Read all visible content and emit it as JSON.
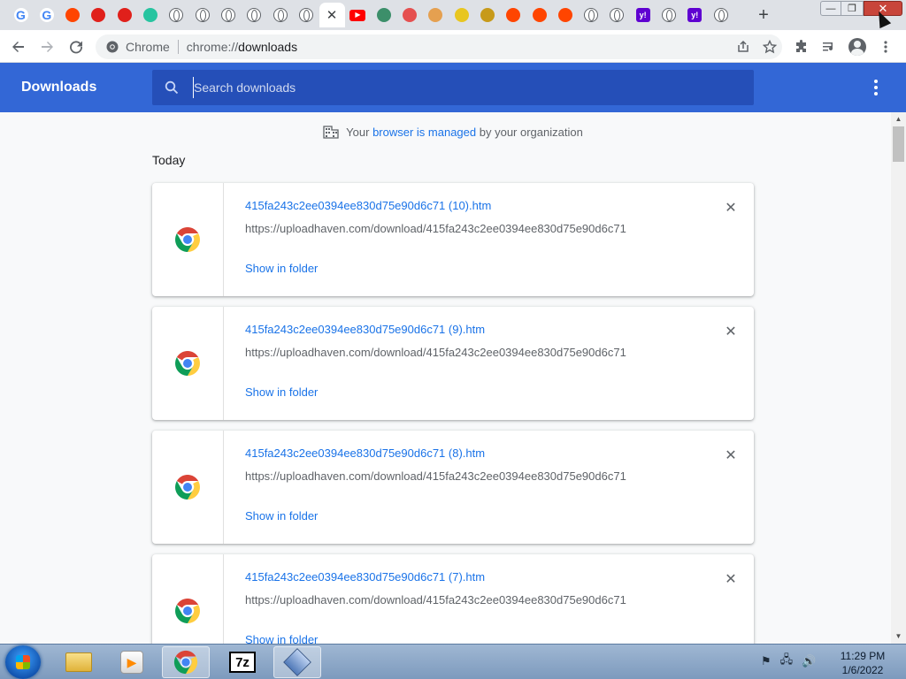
{
  "tabs": [
    {
      "icon": "google-icon",
      "label": "G",
      "color": "#4285f4"
    },
    {
      "icon": "google-icon",
      "label": "G",
      "color": "#4285f4"
    },
    {
      "icon": "reddit-icon",
      "label": "",
      "color": "#ff4500"
    },
    {
      "icon": "app-icon-red",
      "label": "",
      "color": "#e0201b"
    },
    {
      "icon": "app-icon-red",
      "label": "",
      "color": "#e0201b"
    },
    {
      "icon": "app-icon-teal",
      "label": "",
      "color": "#27c4a0"
    },
    {
      "icon": "globe-icon",
      "label": "",
      "color": "#5f6368"
    },
    {
      "icon": "globe-icon",
      "label": "",
      "color": "#5f6368"
    },
    {
      "icon": "globe-icon",
      "label": "",
      "color": "#5f6368"
    },
    {
      "icon": "globe-icon",
      "label": "",
      "color": "#5f6368"
    },
    {
      "icon": "globe-icon",
      "label": "",
      "color": "#5f6368"
    },
    {
      "icon": "globe-icon",
      "label": "",
      "color": "#5f6368"
    },
    {
      "icon": "close-icon",
      "label": "✕",
      "color": "#3c4043",
      "active": true
    },
    {
      "icon": "youtube-icon",
      "label": "▶",
      "color": "#ff0000"
    },
    {
      "icon": "cat-icon",
      "label": "",
      "color": "#3c8f6a"
    },
    {
      "icon": "app-icon-red",
      "label": "",
      "color": "#e55050"
    },
    {
      "icon": "app-icon-orange",
      "label": "",
      "color": "#e5a050"
    },
    {
      "icon": "app-icon-yellow",
      "label": "",
      "color": "#e8c620"
    },
    {
      "icon": "app-icon-badge",
      "label": "",
      "color": "#c79a1a"
    },
    {
      "icon": "reddit-icon",
      "label": "",
      "color": "#ff4500"
    },
    {
      "icon": "reddit-icon",
      "label": "",
      "color": "#ff4500"
    },
    {
      "icon": "reddit-icon",
      "label": "",
      "color": "#ff4500"
    },
    {
      "icon": "globe-icon",
      "label": "",
      "color": "#5f6368"
    },
    {
      "icon": "globe-icon",
      "label": "",
      "color": "#5f6368"
    },
    {
      "icon": "yahoo-icon",
      "label": "y!",
      "color": "#5f01d1"
    },
    {
      "icon": "globe-icon",
      "label": "",
      "color": "#5f6368"
    },
    {
      "icon": "yahoo-icon",
      "label": "y!",
      "color": "#5f01d1"
    },
    {
      "icon": "globe-icon",
      "label": "",
      "color": "#5f6368"
    }
  ],
  "window": {
    "minimize": "—",
    "maximize": "❐",
    "close": "✕"
  },
  "toolbar": {
    "chip_label": "Chrome",
    "url_scheme": "chrome://",
    "url_path": "downloads"
  },
  "downloads": {
    "title": "Downloads",
    "search_placeholder": "Search downloads",
    "managed_prefix": "Your",
    "managed_link": "browser is managed",
    "managed_suffix": "by your organization",
    "section_date": "Today",
    "show_in_folder": "Show in folder",
    "items": [
      {
        "filename": "415fa243c2ee0394ee830d75e90d6c71 (10).htm",
        "url": "https://uploadhaven.com/download/415fa243c2ee0394ee830d75e90d6c71"
      },
      {
        "filename": "415fa243c2ee0394ee830d75e90d6c71 (9).htm",
        "url": "https://uploadhaven.com/download/415fa243c2ee0394ee830d75e90d6c71"
      },
      {
        "filename": "415fa243c2ee0394ee830d75e90d6c71 (8).htm",
        "url": "https://uploadhaven.com/download/415fa243c2ee0394ee830d75e90d6c71"
      },
      {
        "filename": "415fa243c2ee0394ee830d75e90d6c71 (7).htm",
        "url": "https://uploadhaven.com/download/415fa243c2ee0394ee830d75e90d6c71"
      }
    ]
  },
  "taskbar": {
    "items": [
      "windows-explorer",
      "windows-media-player",
      "google-chrome",
      "7-zip",
      "virtualbox"
    ],
    "active": "google-chrome",
    "time": "11:29 PM",
    "date": "1/6/2022"
  },
  "colors": {
    "header_blue": "#3367d6",
    "search_blue": "#254fb8",
    "link_blue": "#1a73e8"
  }
}
